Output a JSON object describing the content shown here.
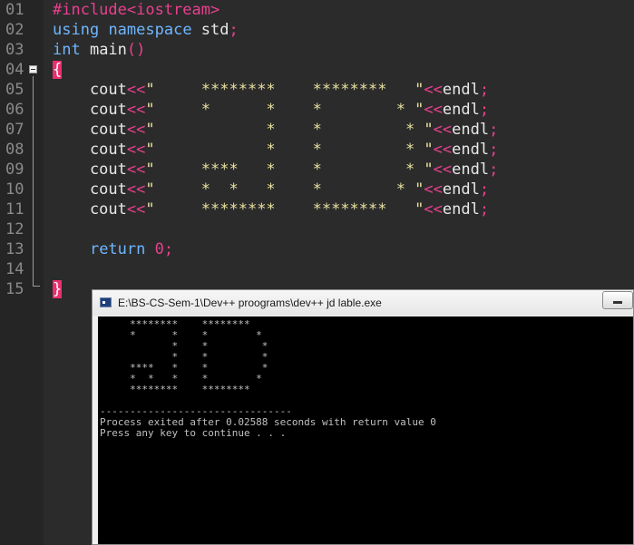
{
  "editor": {
    "lines": [
      {
        "num": "01",
        "text": "#include<iostream>"
      },
      {
        "num": "02",
        "text": "using namespace std;"
      },
      {
        "num": "03",
        "text": "int main()"
      },
      {
        "num": "04",
        "text": "{"
      },
      {
        "num": "05",
        "text": "    cout<<\"     ********    ********   \"<<endl;"
      },
      {
        "num": "06",
        "text": "    cout<<\"     *      *    *        * \"<<endl;"
      },
      {
        "num": "07",
        "text": "    cout<<\"            *    *         * \"<<endl;"
      },
      {
        "num": "08",
        "text": "    cout<<\"            *    *         * \"<<endl;"
      },
      {
        "num": "09",
        "text": "    cout<<\"     ****   *    *         * \"<<endl;"
      },
      {
        "num": "10",
        "text": "    cout<<\"     *  *   *    *        * \"<<endl;"
      },
      {
        "num": "11",
        "text": "    cout<<\"     ********    ********   \"<<endl;"
      },
      {
        "num": "12",
        "text": ""
      },
      {
        "num": "13",
        "text": "    return 0;"
      },
      {
        "num": "14",
        "text": ""
      },
      {
        "num": "15",
        "text": "}"
      }
    ]
  },
  "console": {
    "title": "E:\\BS-CS-Sem-1\\Dev++ proograms\\dev++ jd lable.exe",
    "output": [
      "     ********    ********",
      "     *      *    *        *",
      "            *    *         *",
      "            *    *         *",
      "     ****   *    *         *",
      "     *  *   *    *        *",
      "     ********    ********",
      "",
      "--------------------------------",
      "Process exited after 0.02588 seconds with return value 0",
      "Press any key to continue . . ."
    ]
  },
  "colors": {
    "editor_bg": "#2b2b2b",
    "preprocessor": "#e8408e",
    "keyword": "#6fb6ff",
    "string": "#e9e1a0",
    "brace_highlight": "#e8306e",
    "terminal_bg": "#000000",
    "terminal_fg": "#c0c0c0"
  },
  "icons": [
    "fold-collapse-icon",
    "console-app-icon",
    "minimize-icon"
  ]
}
